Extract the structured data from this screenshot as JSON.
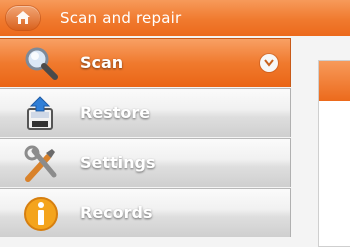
{
  "window": {
    "title": "Scan and repair"
  },
  "nav": {
    "items": [
      {
        "id": "scan",
        "label": "Scan",
        "icon": "magnifier-icon",
        "active": true
      },
      {
        "id": "restore",
        "label": "Restore",
        "icon": "restore-icon",
        "active": false
      },
      {
        "id": "settings",
        "label": "Settings",
        "icon": "tools-icon",
        "active": false
      },
      {
        "id": "records",
        "label": "Records",
        "icon": "info-icon",
        "active": false
      }
    ]
  },
  "colors": {
    "accent": "#f07a2e",
    "nav_gray": "#dcdcdc"
  }
}
